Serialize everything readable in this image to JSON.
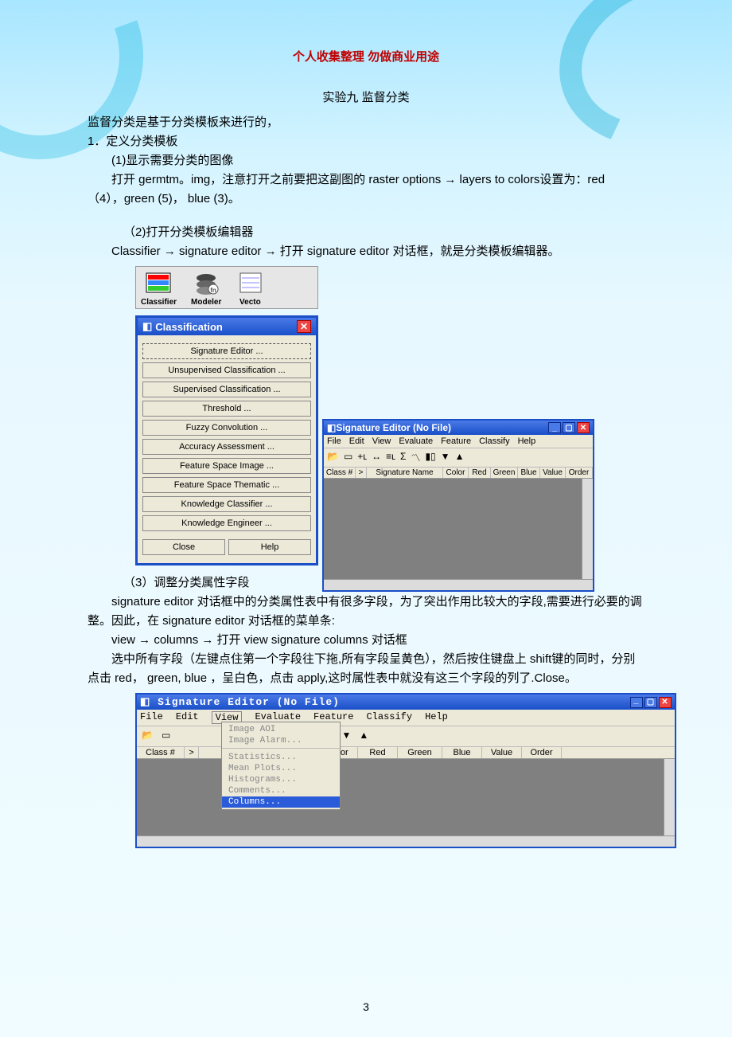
{
  "header": "个人收集整理  勿做商业用途",
  "title": "实验九    监督分类",
  "p1": "监督分类是基于分类模板来进行的，",
  "s1": "1．定义分类模板",
  "s1_1": "(1)显示需要分类的图像",
  "p2": "打开 germtm。img，注意打开之前要把这副图的 raster options  →  layers to colors设置为：red （4），green (5)， blue (3)。",
  "s1_2": "（2)打开分类模板编辑器",
  "p3": "Classifier → signature editor  → 打开 signature editor 对话框，就是分类模板编辑器。",
  "topicons": {
    "classifier": "Classifier",
    "modeler": "Modeler",
    "vector": "Vecto"
  },
  "classify": {
    "title": "Classification",
    "buttons": [
      "Signature Editor ...",
      "Unsupervised Classification ...",
      "Supervised Classification ...",
      "Threshold ...",
      "Fuzzy Convolution ...",
      "Accuracy Assessment ...",
      "Feature Space Image ...",
      "Feature Space Thematic ...",
      "Knowledge Classifier ...",
      "Knowledge Engineer ..."
    ],
    "close": "Close",
    "help": "Help"
  },
  "sig1": {
    "title": "Signature Editor (No File)",
    "menu": [
      "File",
      "Edit",
      "View",
      "Evaluate",
      "Feature",
      "Classify",
      "Help"
    ],
    "cols": [
      "Class #",
      ">",
      "Signature Name",
      "Color",
      "Red",
      "Green",
      "Blue",
      "Value",
      "Order"
    ]
  },
  "s1_3": "（3）调整分类属性字段",
  "p4": "signature editor 对话框中的分类属性表中有很多字段，为了突出作用比较大的字段,需要进行必要的调整。因此，在 signature editor 对话框的菜单条:",
  "p5": "view  →  columns  →  打开 view signature columns 对话框",
  "p6": "选中所有字段（左键点住第一个字段往下拖,所有字段呈黄色），然后按住键盘上 shift键的同时，分别点击 red， green, blue ，呈白色，点击 apply,这时属性表中就没有这三个字段的列了.Close。",
  "sig2": {
    "title": "Signature Editor (No File)",
    "menu": [
      "File",
      "Edit",
      "View",
      "Evaluate",
      "Feature",
      "Classify",
      "Help"
    ],
    "viewmenu": [
      "Image AOI",
      "Image Alarm...",
      "Statistics...",
      "Mean Plots...",
      "Histograms...",
      "Comments...",
      "Columns..."
    ],
    "cols": [
      "Class #",
      ">",
      "",
      "Color",
      "Red",
      "Green",
      "Blue",
      "Value",
      "Order"
    ]
  },
  "page": "3"
}
